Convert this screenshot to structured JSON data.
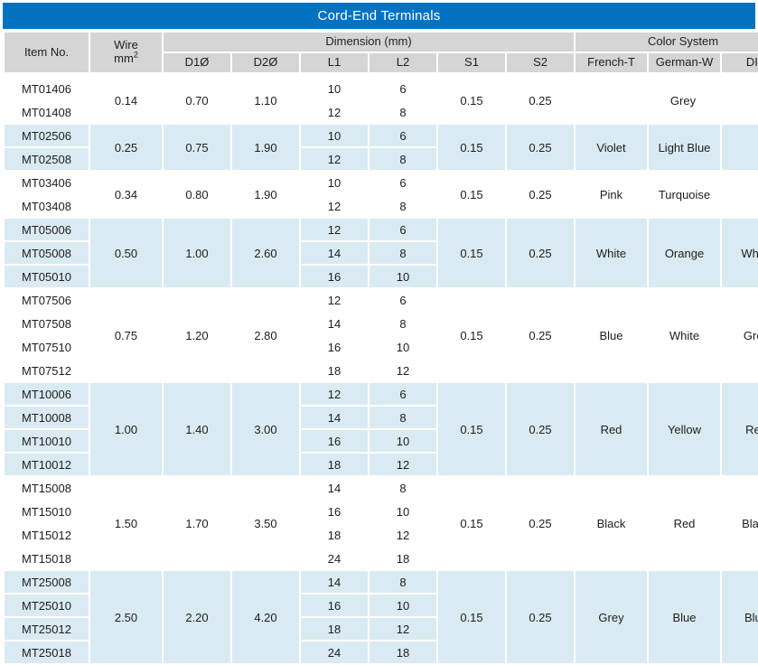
{
  "title": "Cord-End Terminals",
  "accent_color": "#0072c0",
  "header_bg": "#d5d5d5",
  "band_bg": "#daeaf2",
  "header": {
    "item_no": "Item No.",
    "wire_line1": "Wire",
    "wire_line2": "mm",
    "wire_sup": "2",
    "dimension_group": "Dimension (mm)",
    "color_group": "Color System",
    "d1": "D1Ø",
    "d2": "D2Ø",
    "l1": "L1",
    "l2": "L2",
    "s1": "S1",
    "s2": "S2",
    "french": "French-T",
    "german": "German-W",
    "din": "DIN"
  },
  "groups": [
    {
      "banded": false,
      "wire": "0.14",
      "d1": "0.70",
      "d2": "1.10",
      "s1": "0.15",
      "s2": "0.25",
      "color_merged": "Grey",
      "french": "",
      "german": "",
      "din": "",
      "rows": [
        {
          "item": "MT01406",
          "l1": "10",
          "l2": "6"
        },
        {
          "item": "MT01408",
          "l1": "12",
          "l2": "8"
        }
      ]
    },
    {
      "banded": true,
      "wire": "0.25",
      "d1": "0.75",
      "d2": "1.90",
      "s1": "0.15",
      "s2": "0.25",
      "color_merged": "",
      "french": "Violet",
      "german": "Light Blue",
      "din": "",
      "rows": [
        {
          "item": "MT02506",
          "l1": "10",
          "l2": "6"
        },
        {
          "item": "MT02508",
          "l1": "12",
          "l2": "8"
        }
      ]
    },
    {
      "banded": false,
      "wire": "0.34",
      "d1": "0.80",
      "d2": "1.90",
      "s1": "0.15",
      "s2": "0.25",
      "color_merged": "",
      "french": "Pink",
      "german": "Turquoise",
      "din": "",
      "rows": [
        {
          "item": "MT03406",
          "l1": "10",
          "l2": "6"
        },
        {
          "item": "MT03408",
          "l1": "12",
          "l2": "8"
        }
      ]
    },
    {
      "banded": true,
      "wire": "0.50",
      "d1": "1.00",
      "d2": "2.60",
      "s1": "0.15",
      "s2": "0.25",
      "color_merged": "",
      "french": "White",
      "german": "Orange",
      "din": "White",
      "rows": [
        {
          "item": "MT05006",
          "l1": "12",
          "l2": "6"
        },
        {
          "item": "MT05008",
          "l1": "14",
          "l2": "8"
        },
        {
          "item": "MT05010",
          "l1": "16",
          "l2": "10"
        }
      ]
    },
    {
      "banded": false,
      "wire": "0.75",
      "d1": "1.20",
      "d2": "2.80",
      "s1": "0.15",
      "s2": "0.25",
      "color_merged": "",
      "french": "Blue",
      "german": "White",
      "din": "Grey",
      "rows": [
        {
          "item": "MT07506",
          "l1": "12",
          "l2": "6"
        },
        {
          "item": "MT07508",
          "l1": "14",
          "l2": "8"
        },
        {
          "item": "MT07510",
          "l1": "16",
          "l2": "10"
        },
        {
          "item": "MT07512",
          "l1": "18",
          "l2": "12"
        }
      ]
    },
    {
      "banded": true,
      "wire": "1.00",
      "d1": "1.40",
      "d2": "3.00",
      "s1": "0.15",
      "s2": "0.25",
      "color_merged": "",
      "french": "Red",
      "german": "Yellow",
      "din": "Red",
      "rows": [
        {
          "item": "MT10006",
          "l1": "12",
          "l2": "6"
        },
        {
          "item": "MT10008",
          "l1": "14",
          "l2": "8"
        },
        {
          "item": "MT10010",
          "l1": "16",
          "l2": "10"
        },
        {
          "item": "MT10012",
          "l1": "18",
          "l2": "12"
        }
      ]
    },
    {
      "banded": false,
      "wire": "1.50",
      "d1": "1.70",
      "d2": "3.50",
      "s1": "0.15",
      "s2": "0.25",
      "color_merged": "",
      "french": "Black",
      "german": "Red",
      "din": "Black",
      "rows": [
        {
          "item": "MT15008",
          "l1": "14",
          "l2": "8"
        },
        {
          "item": "MT15010",
          "l1": "16",
          "l2": "10"
        },
        {
          "item": "MT15012",
          "l1": "18",
          "l2": "12"
        },
        {
          "item": "MT15018",
          "l1": "24",
          "l2": "18"
        }
      ]
    },
    {
      "banded": true,
      "wire": "2.50",
      "d1": "2.20",
      "d2": "4.20",
      "s1": "0.15",
      "s2": "0.25",
      "color_merged": "",
      "french": "Grey",
      "german": "Blue",
      "din": "Blue",
      "rows": [
        {
          "item": "MT25008",
          "l1": "14",
          "l2": "8"
        },
        {
          "item": "MT25010",
          "l1": "16",
          "l2": "10"
        },
        {
          "item": "MT25012",
          "l1": "18",
          "l2": "12"
        },
        {
          "item": "MT25018",
          "l1": "24",
          "l2": "18"
        }
      ]
    }
  ]
}
